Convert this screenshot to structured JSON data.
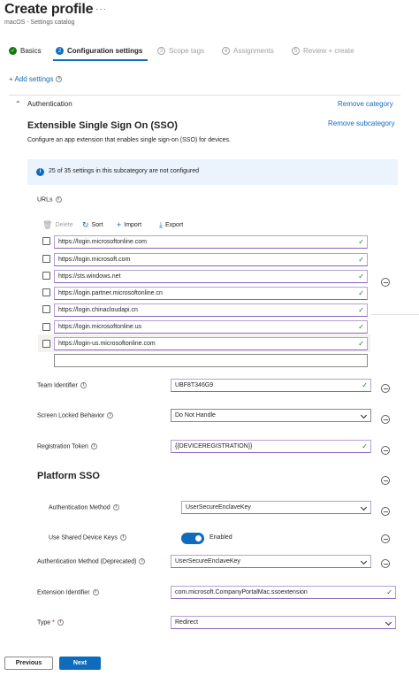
{
  "header": {
    "title": "Create profile",
    "more": "···",
    "subtitle": "macOS - Settings catalog"
  },
  "steps": [
    {
      "num": "✓",
      "label": "Basics",
      "state": "done"
    },
    {
      "num": "2",
      "label": "Configuration settings",
      "state": "active"
    },
    {
      "num": "3",
      "label": "Scope tags",
      "state": "pending"
    },
    {
      "num": "4",
      "label": "Assignments",
      "state": "pending"
    },
    {
      "num": "5",
      "label": "Review + create",
      "state": "pending"
    }
  ],
  "add_settings": "+ Add settings",
  "category": {
    "name": "Authentication",
    "remove": "Remove category"
  },
  "subcategory": {
    "title": "Extensible Single Sign On (SSO)",
    "remove": "Remove subcategory",
    "description": "Configure an app extension that enables single sign-on (SSO) for devices.",
    "banner": "25 of 35 settings in this subcategory are not configured"
  },
  "urls": {
    "label": "URLs",
    "toolbar": {
      "delete": "Delete",
      "sort": "Sort",
      "import": "Import",
      "export": "Export"
    },
    "items": [
      "https://login.microsoftonline.com",
      "https://login.microsoft.com",
      "https://sts.windows.net",
      "https://login.partner.microsoftonline.cn",
      "https://login.chinacloudapi.cn",
      "https://login.microsoftonline.us",
      "https://login-us.microsoftonline.com"
    ]
  },
  "fields": {
    "team_identifier": {
      "label": "Team Identifier",
      "value": "UBF8T346G9"
    },
    "screen_locked": {
      "label": "Screen Locked Behavior",
      "value": "Do Not Handle"
    },
    "registration_token": {
      "label": "Registration Token",
      "value": "{{DEVICEREGISTRATION}}"
    },
    "platform_sso": "Platform SSO",
    "auth_method": {
      "label": "Authentication Method",
      "value": "UserSecureEnclaveKey"
    },
    "shared_keys": {
      "label": "Use Shared Device Keys",
      "value": "Enabled"
    },
    "auth_method_deprecated": {
      "label": "Authentication Method (Deprecated)",
      "value": "UserSecureEnclaveKey"
    },
    "extension_identifier": {
      "label": "Extension Identifier",
      "value": "com.microsoft.CompanyPortalMac.ssoextension"
    },
    "type": {
      "label": "Type",
      "required": "*",
      "value": "Redirect"
    }
  },
  "footer": {
    "previous": "Previous",
    "next": "Next"
  },
  "colors": {
    "accent": "#0f6cbd",
    "success": "#107c10",
    "field_border": "#8764b8"
  }
}
